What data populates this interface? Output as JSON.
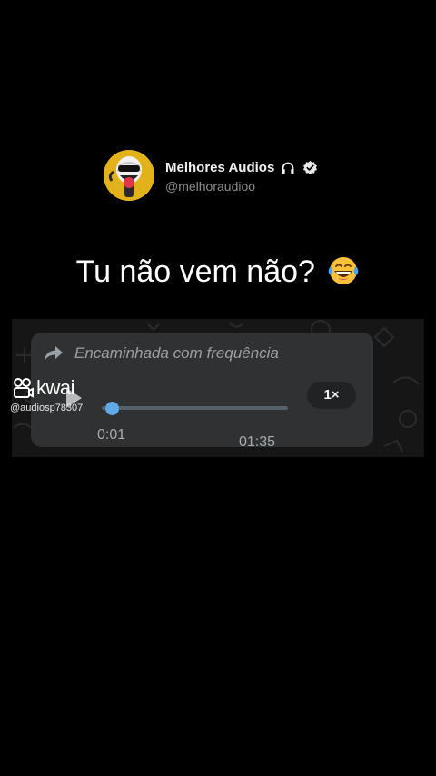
{
  "post": {
    "author_name": "Melhores Audios",
    "handle": "@melhoraudioo",
    "name_icons": [
      "headphones-icon",
      "verified-badge-icon"
    ],
    "caption_text": "Tu não vem não?",
    "caption_emoji": "face-with-tears-of-joy-icon"
  },
  "voice_message": {
    "forwarded_label": "Encaminhada com frequência",
    "elapsed": "0:01",
    "duration": "01:35",
    "progress": 0.02,
    "speed": "1×",
    "state_icon": "play-icon",
    "accent_color": "#5fa9e6",
    "bubble_color": "#2f3132"
  },
  "watermark": {
    "brand": "kwai",
    "username": "@audiosp78307"
  }
}
